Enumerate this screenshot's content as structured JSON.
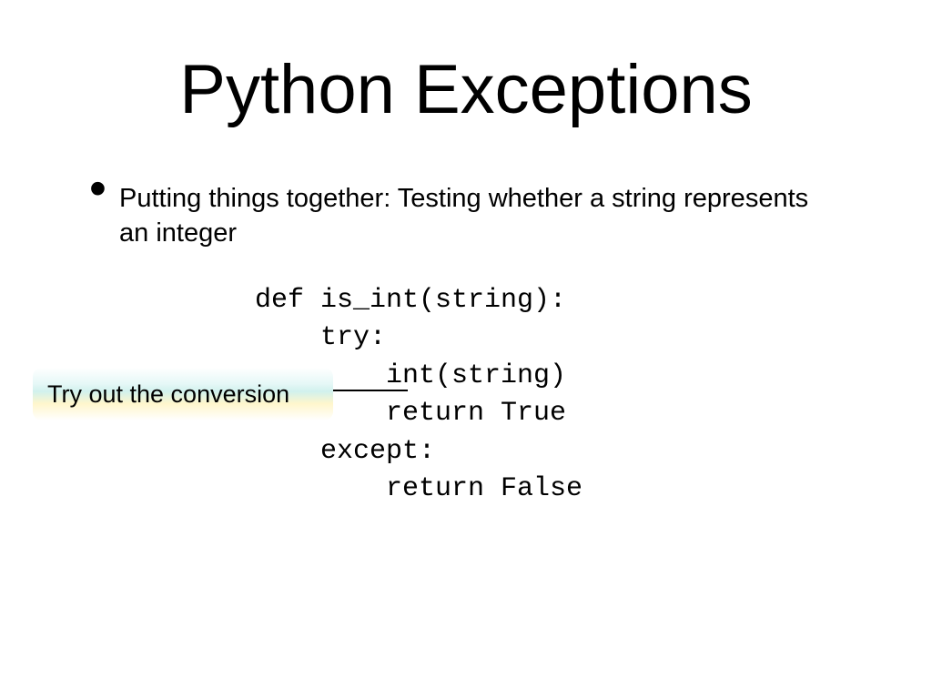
{
  "title": "Python Exceptions",
  "bullet": "Putting things together: Testing whether a string represents an integer",
  "code": "def is_int(string):\n    try:\n        int(string)\n        return True\n    except:\n        return False",
  "callout": "Try out the conversion"
}
